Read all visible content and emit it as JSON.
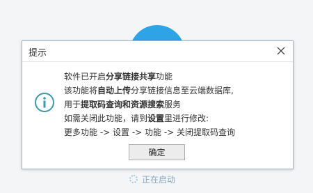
{
  "dialog": {
    "title": "提示",
    "lines": [
      {
        "p1": "软件已开启",
        "b1": "分享链接共享",
        "p2": "功能"
      },
      {
        "p1": "该功能将",
        "b1": "自动上传",
        "p2": "分享链接信息至云端数据库,"
      },
      {
        "p1": "用于",
        "b1": "提取码查询和资源搜索",
        "p2": "服务"
      },
      {
        "p1": "如需关闭此功能，请到",
        "b1": "设置",
        "p2": "里进行修改:"
      },
      {
        "p1": "更多功能 -> 设置 -> 功能 -> 关闭提取码查询",
        "b1": "",
        "p2": ""
      }
    ],
    "ok_label": "确定"
  },
  "status": {
    "text": "正在启动"
  },
  "icons": {
    "info": "info-icon",
    "close": "close-icon",
    "loading": "loading-icon"
  },
  "colors": {
    "accent": "#2ea4e6",
    "icon_teal": "#3a9aa8"
  }
}
